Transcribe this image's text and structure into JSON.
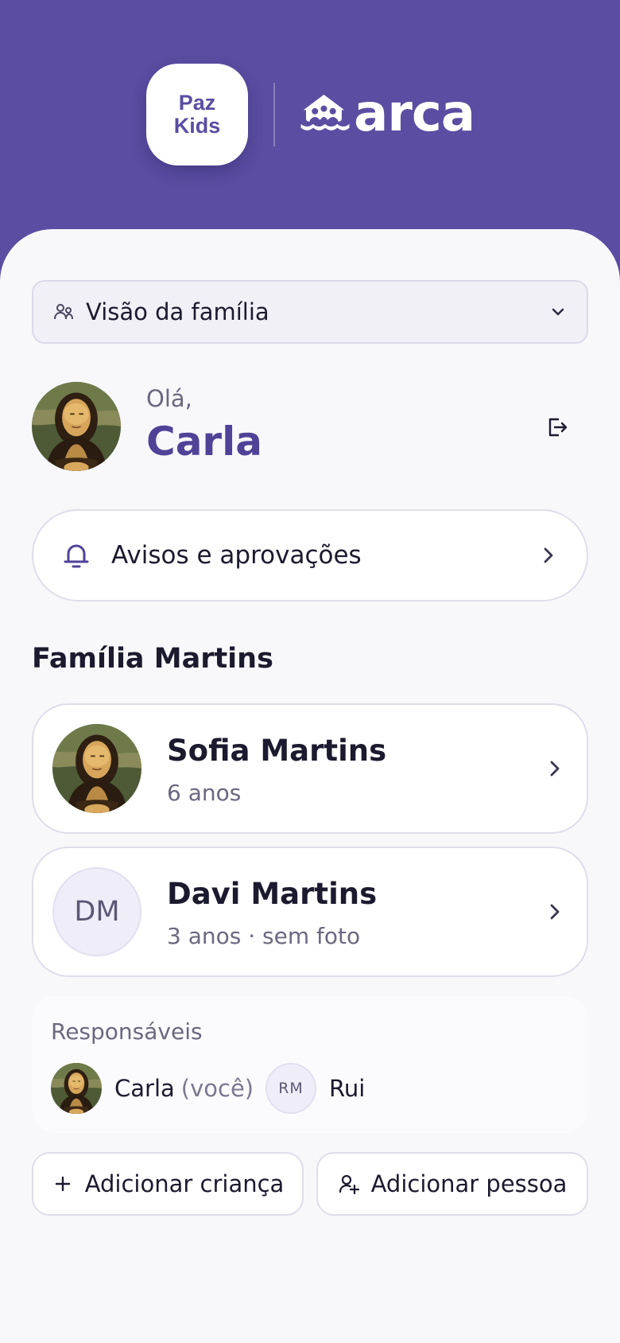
{
  "header": {
    "badge_line1": "Paz",
    "badge_line2": "Kids",
    "brand_name": "arca",
    "icon": "ark-boat-icon"
  },
  "family_select": {
    "label": "Visão da família",
    "icon": "family-icon",
    "chevron": "chevron-down-icon"
  },
  "greeting": {
    "hello": "Olá,",
    "name": "Carla",
    "logout_icon": "logout-icon"
  },
  "notices": {
    "label": "Avisos e aprovações",
    "icon": "bell-icon"
  },
  "family": {
    "title": "Família Martins",
    "children": [
      {
        "name": "Sofia Martins",
        "subtitle": "6 anos",
        "photo": "portrait"
      },
      {
        "name": "Davi Martins",
        "subtitle": "3 anos · sem foto",
        "initials": "DM"
      }
    ]
  },
  "guardians": {
    "title": "Responsáveis",
    "people": [
      {
        "name": "Carla",
        "suffix": "(você)",
        "photo": "portrait"
      },
      {
        "name": "Rui",
        "initials": "RM"
      }
    ]
  },
  "actions": {
    "add_child": "Adicionar criança",
    "add_person": "Adicionar pessoa"
  },
  "colors": {
    "brand": "#5a4da2",
    "accent_text": "#4f4297",
    "background": "#f8f8fb"
  }
}
